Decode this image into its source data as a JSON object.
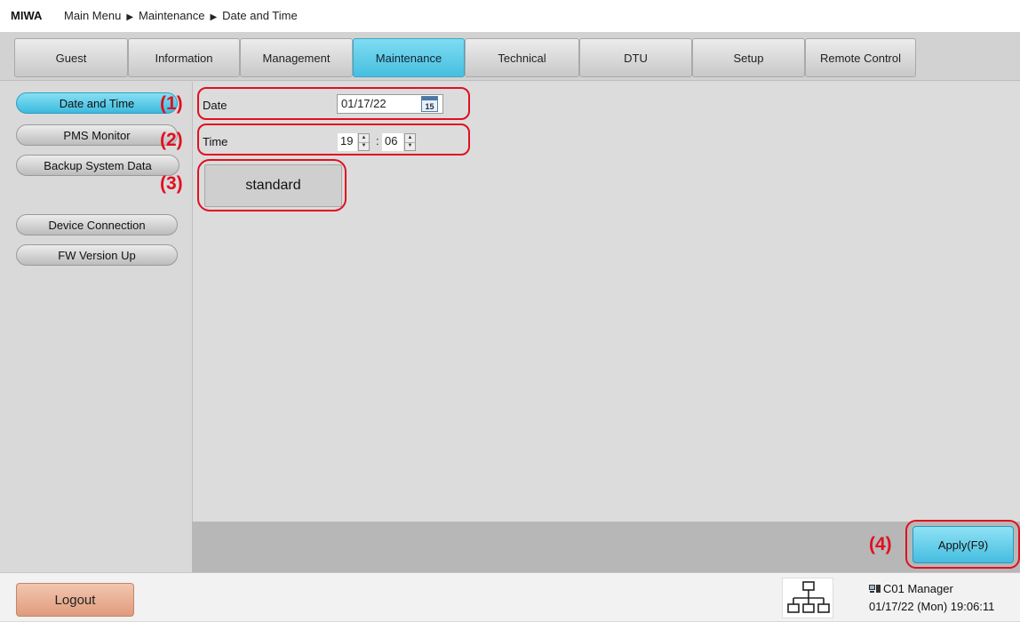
{
  "header": {
    "brand": "MIWA",
    "breadcrumb": [
      "Main Menu",
      "Maintenance",
      "Date and Time"
    ]
  },
  "tabs": [
    {
      "label": "Guest",
      "active": false
    },
    {
      "label": "Information",
      "active": false
    },
    {
      "label": "Management",
      "active": false
    },
    {
      "label": "Maintenance",
      "active": true
    },
    {
      "label": "Technical",
      "active": false
    },
    {
      "label": "DTU",
      "active": false
    },
    {
      "label": "Setup",
      "active": false
    },
    {
      "label": "Remote Control",
      "active": false
    }
  ],
  "sidebar": {
    "items": [
      {
        "label": "Date and Time",
        "active": true
      },
      {
        "label": "PMS Monitor",
        "active": false
      },
      {
        "label": "Backup System Data",
        "active": false
      },
      {
        "label": "Device Connection",
        "active": false
      },
      {
        "label": "FW Version Up",
        "active": false
      }
    ]
  },
  "form": {
    "date_label": "Date",
    "date_value": "01/17/22",
    "calendar_icon_text": "15",
    "time_label": "Time",
    "hour_value": "19",
    "time_separator": ":",
    "minute_value": "06",
    "standard_label": "standard"
  },
  "actions": {
    "apply_label": "Apply(F9)"
  },
  "annotations": {
    "date": "(1)",
    "time": "(2)",
    "standard": "(3)",
    "apply": "(4)"
  },
  "footer": {
    "logout_label": "Logout",
    "user": "C01 Manager",
    "datetime": "01/17/22 (Mon) 19:06:11"
  },
  "colors": {
    "accent": "#46bfe0",
    "annotation": "#e01020",
    "logout": "#df9c7d"
  }
}
